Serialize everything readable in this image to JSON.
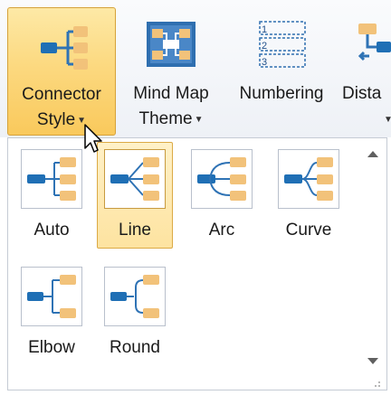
{
  "ribbon": {
    "connector_style": {
      "line1": "Connector",
      "line2": "Style",
      "icon": "connector-style-icon"
    },
    "mind_map_theme": {
      "line1": "Mind Map",
      "line2": "Theme",
      "icon": "mind-map-theme-icon"
    },
    "numbering": {
      "line1": "Numbering",
      "icon": "numbering-icon"
    },
    "distance": {
      "line1": "Dista",
      "icon": "distance-icon"
    }
  },
  "gallery": {
    "selected": "Line",
    "items": [
      {
        "label": "Auto",
        "style": "auto"
      },
      {
        "label": "Line",
        "style": "line"
      },
      {
        "label": "Arc",
        "style": "arc"
      },
      {
        "label": "Curve",
        "style": "curve"
      },
      {
        "label": "Elbow",
        "style": "elbow"
      },
      {
        "label": "Round",
        "style": "round"
      }
    ]
  },
  "colors": {
    "node_blue": "#1f6fb5",
    "topic_tan": "#f2c27a",
    "connector_blue": "#2f73b5",
    "selection_gold": "#fcd980"
  }
}
